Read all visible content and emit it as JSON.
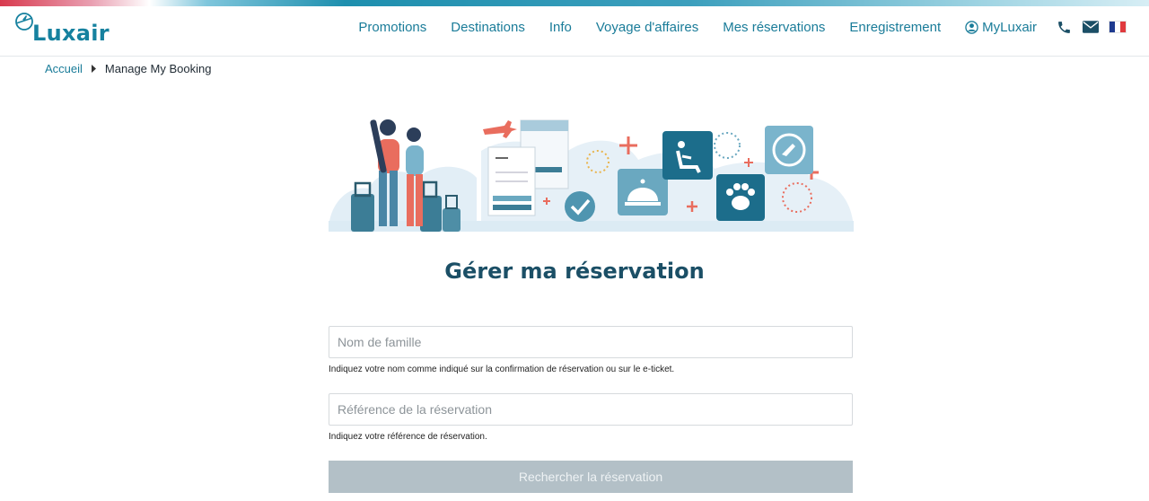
{
  "header": {
    "logo_text": "Luxair",
    "nav": [
      {
        "label": "Promotions"
      },
      {
        "label": "Destinations"
      },
      {
        "label": "Info"
      },
      {
        "label": "Voyage d'affaires"
      },
      {
        "label": "Mes réservations"
      },
      {
        "label": "Enregistrement"
      }
    ],
    "account_label": "MyLuxair",
    "icons": [
      "phone-icon",
      "mail-icon",
      "french-flag-icon"
    ],
    "colors": {
      "brand": "#16819f",
      "nav_text": "#1a7c99",
      "title": "#1b4f66"
    }
  },
  "breadcrumb": {
    "home": "Accueil",
    "current": "Manage My Booking"
  },
  "main": {
    "title": "Gérer ma réservation",
    "lastname": {
      "placeholder": "Nom de famille",
      "value": "",
      "help": "Indiquez votre nom comme indiqué sur la confirmation de réservation ou sur le e-ticket."
    },
    "reference": {
      "placeholder": "Référence de la réservation",
      "value": "",
      "help": "Indiquez votre référence de réservation."
    },
    "search_button": "Rechercher la réservation",
    "button_color": "#b3c0c7"
  }
}
